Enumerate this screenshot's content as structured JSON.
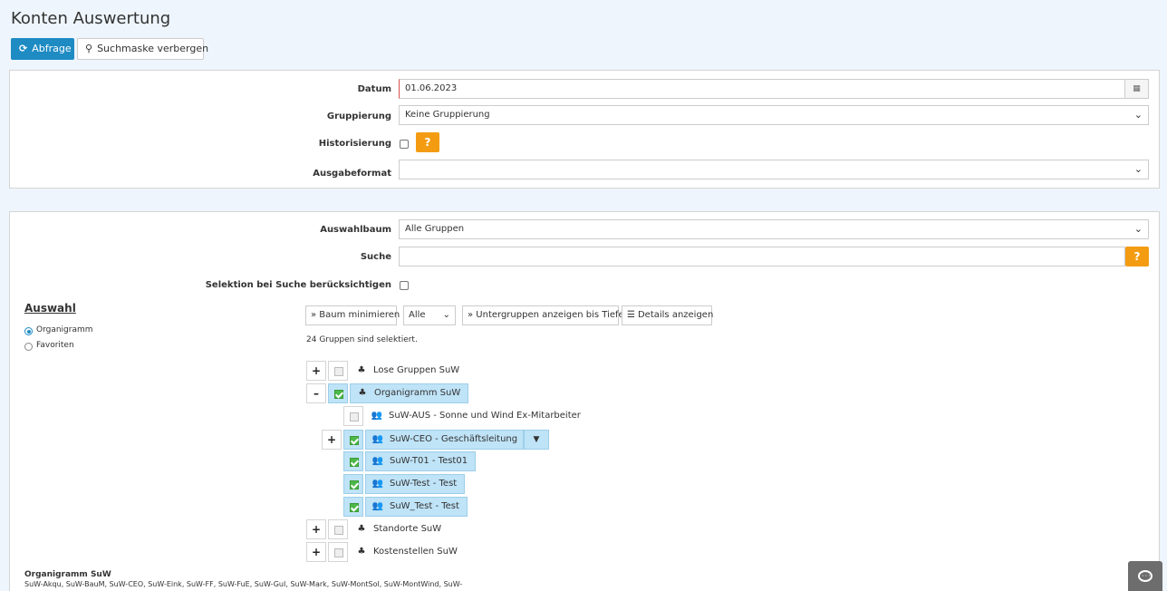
{
  "page": {
    "title": "Konten Auswertung"
  },
  "toolbar": {
    "query_label": "Abfrage",
    "query_icon": "refresh-icon",
    "hide_search_label": "Suchmaske verbergen",
    "hide_search_icon": "search-icon"
  },
  "form": {
    "datum_label": "Datum",
    "datum_value": "01.06.2023",
    "gruppierung_label": "Gruppierung",
    "gruppierung_value": "Keine Gruppierung",
    "historisierung_label": "Historisierung",
    "historisierung_checked": false,
    "help_label": "?",
    "ausgabeformat_label": "Ausgabeformat",
    "ausgabeformat_value": ""
  },
  "selection": {
    "auswahlbaum_label": "Auswahlbaum",
    "auswahlbaum_value": "Alle Gruppen",
    "suche_label": "Suche",
    "suche_value": "",
    "selektion_label": "Selektion bei Suche berücksichtigen",
    "auswahl_heading": "Auswahl",
    "radio_options": [
      {
        "label": "Organigramm",
        "checked": true
      },
      {
        "label": "Favoriten",
        "checked": false
      }
    ],
    "tree_toolbar": {
      "minimize_label": "» Baum minimieren",
      "filter_value": "Alle",
      "subgroups_label": "» Untergruppen anzeigen bis Tiefe",
      "details_label": "Details anzeigen"
    },
    "selected_count_text": "24 Gruppen sind selektiert."
  },
  "tree": {
    "items": [
      {
        "label": "Lose Gruppen SuW",
        "toggle": "+",
        "checked": false,
        "icon": "group-network-icon"
      },
      {
        "label": "Organigramm SuW",
        "toggle": "–",
        "checked": true,
        "icon": "group-network-icon"
      },
      {
        "label": "SuW-AUS - Sonne und Wind Ex-Mitarbeiter",
        "toggle": "",
        "checked": false,
        "icon": "users-icon"
      },
      {
        "label": "SuW-CEO - Geschäftsleitung",
        "toggle": "+",
        "checked": true,
        "icon": "users-icon"
      },
      {
        "label": "SuW-T01 - Test01",
        "toggle": "",
        "checked": true,
        "icon": "users-icon"
      },
      {
        "label": "SuW-Test - Test",
        "toggle": "",
        "checked": true,
        "icon": "users-icon"
      },
      {
        "label": "SuW_Test - Test",
        "toggle": "",
        "checked": true,
        "icon": "users-icon"
      },
      {
        "label": "Standorte SuW",
        "toggle": "+",
        "checked": false,
        "icon": "group-network-icon"
      },
      {
        "label": "Kostenstellen SuW",
        "toggle": "+",
        "checked": false,
        "icon": "group-network-icon"
      }
    ]
  },
  "summary": {
    "heading": "Organigramm SuW",
    "text": "SuW-Akqu, SuW-BauM, SuW-CEO, SuW-Eink, SuW-FF, SuW-FuE, SuW-GuI, SuW-Mark, SuW-MontSol, SuW-MontWind, SuW-"
  },
  "colors": {
    "primary": "#1e8bc3",
    "help": "#f39c12",
    "selected_bg": "#bfe3f7",
    "check_green": "#4db848"
  }
}
